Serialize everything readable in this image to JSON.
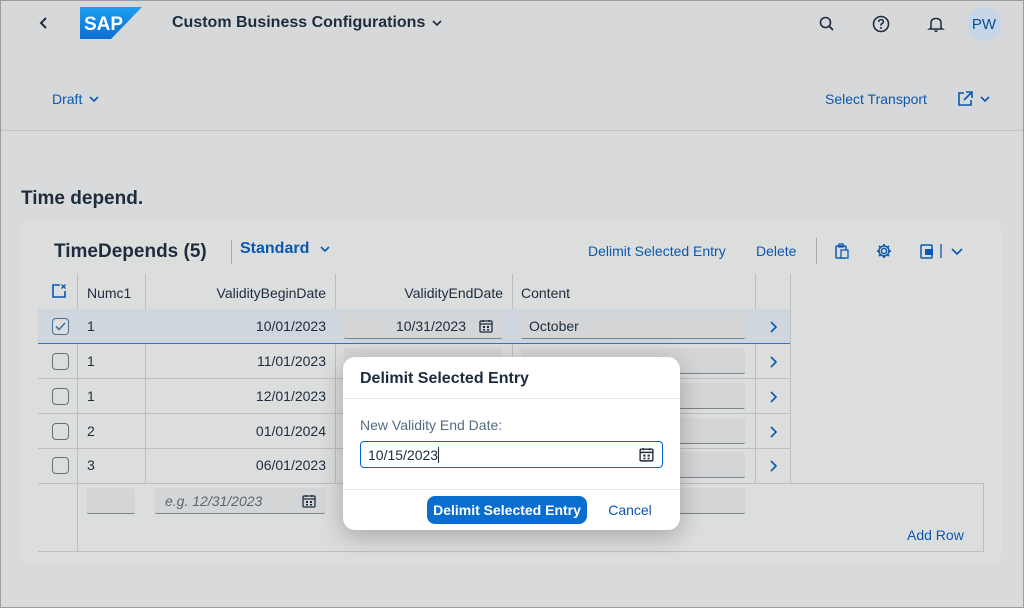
{
  "shell": {
    "brand": "SAP",
    "app_title": "Custom Business Configurations",
    "avatar_initials": "PW",
    "icons": [
      "back-icon",
      "search-icon",
      "help-icon",
      "notification-icon"
    ]
  },
  "header": {
    "draft_label": "Draft",
    "select_transport_label": "Select Transport"
  },
  "section": {
    "title": "Time depend."
  },
  "table": {
    "title": "TimeDepends (5)",
    "variant": "Standard",
    "toolbar": {
      "delimit_label": "Delimit Selected Entry",
      "delete_label": "Delete"
    },
    "columns": {
      "numc1": "Numc1",
      "begin": "ValidityBeginDate",
      "end": "ValidityEndDate",
      "content": "Content"
    },
    "rows": [
      {
        "numc1": "1",
        "begin": "10/01/2023",
        "end": "10/31/2023",
        "content": "October",
        "selected": true
      },
      {
        "numc1": "1",
        "begin": "11/01/2023",
        "end": "",
        "content": "",
        "selected": false
      },
      {
        "numc1": "1",
        "begin": "12/01/2023",
        "end": "",
        "content": "",
        "selected": false
      },
      {
        "numc1": "2",
        "begin": "01/01/2024",
        "end": "",
        "content": "",
        "selected": false
      },
      {
        "numc1": "3",
        "begin": "06/01/2023",
        "end": "",
        "content": "",
        "selected": false
      }
    ],
    "new_row": {
      "begin_placeholder": "e.g. 12/31/2023"
    },
    "add_row_label": "Add Row"
  },
  "dialog": {
    "title": "Delimit Selected Entry",
    "field_label": "New Validity End Date:",
    "field_value": "10/15/2023",
    "confirm_label": "Delimit Selected Entry",
    "cancel_label": "Cancel"
  },
  "colors": {
    "accent": "#0a6ed1",
    "link": "#0a58b0",
    "text": "#1d2d3e"
  }
}
